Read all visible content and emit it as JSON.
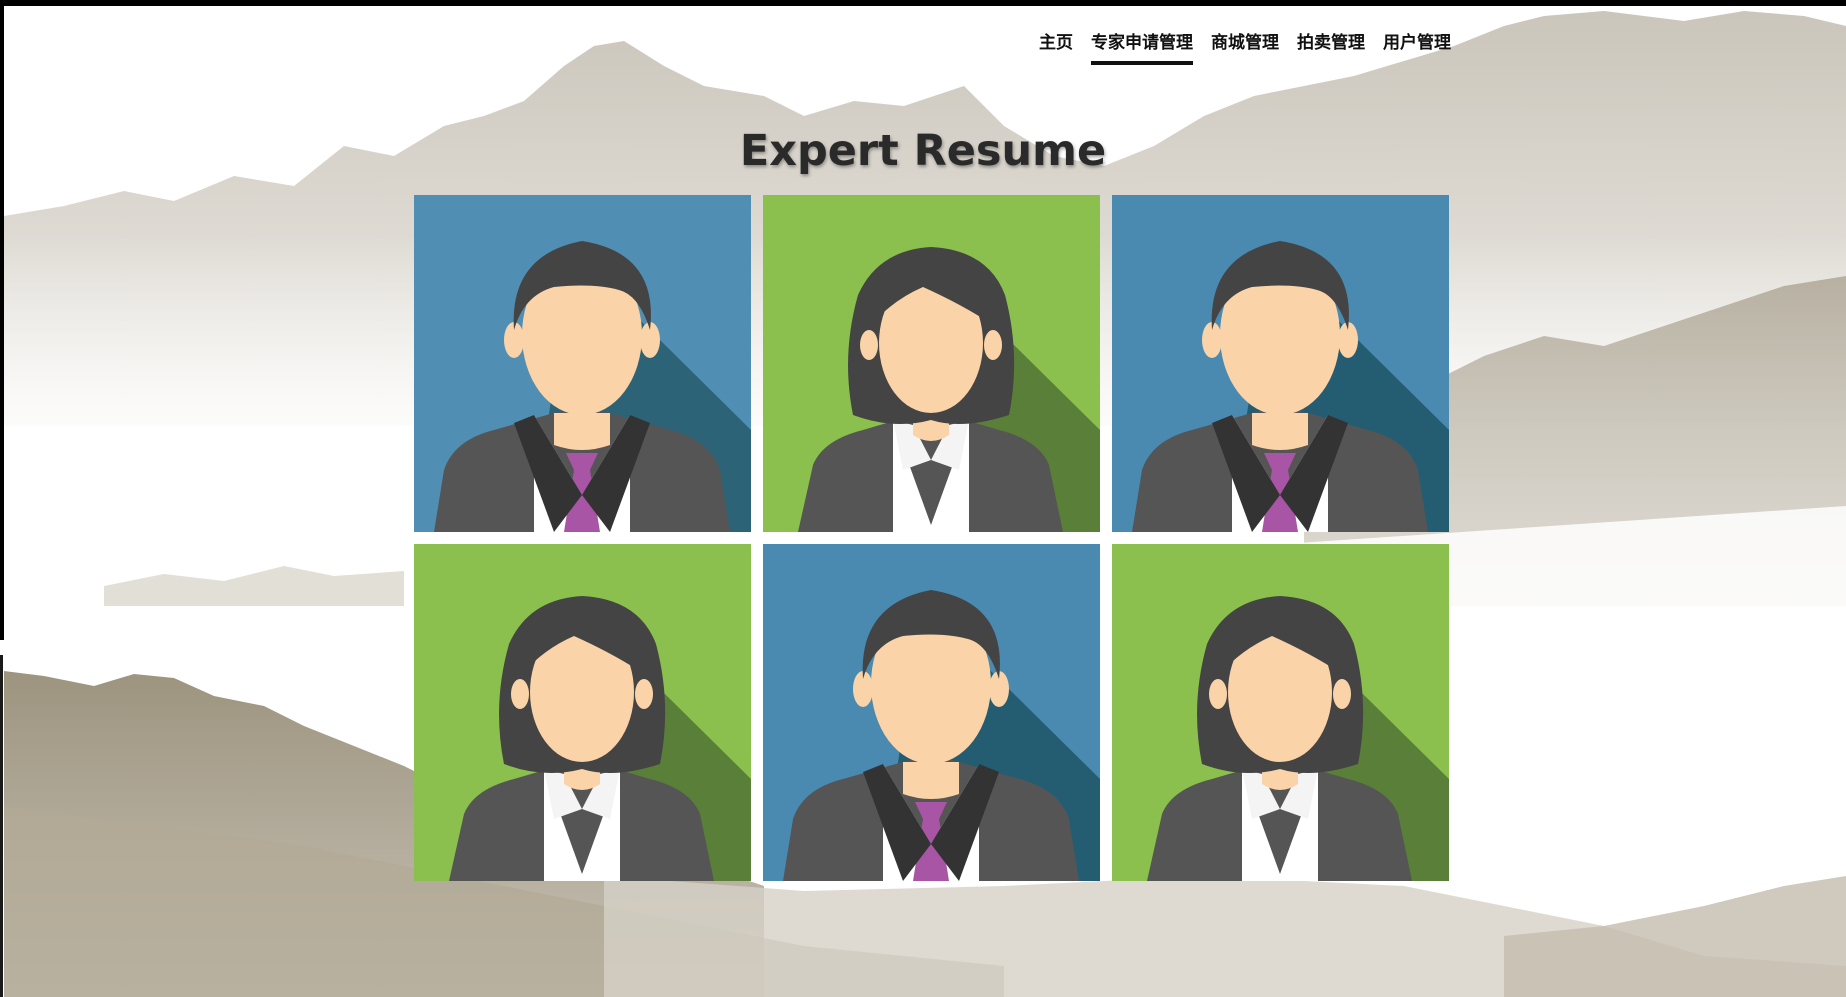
{
  "nav": {
    "items": [
      {
        "label": "主页",
        "active": false
      },
      {
        "label": "专家申请管理",
        "active": true
      },
      {
        "label": "商城管理",
        "active": false
      },
      {
        "label": "拍卖管理",
        "active": false
      },
      {
        "label": "用户管理",
        "active": false
      }
    ]
  },
  "page": {
    "title": "Expert Resume"
  },
  "experts": [
    {
      "avatar": "male-avatar-icon",
      "background": "#4a8ab0"
    },
    {
      "avatar": "female-avatar-icon",
      "background": "#8bc04e"
    },
    {
      "avatar": "male-avatar-icon",
      "background": "#4a8ab0"
    },
    {
      "avatar": "female-avatar-icon",
      "background": "#8bc04e"
    },
    {
      "avatar": "male-avatar-icon",
      "background": "#4a8ab0"
    },
    {
      "avatar": "female-avatar-icon",
      "background": "#8bc04e"
    }
  ],
  "colors": {
    "blue_bg": "#4a8ab0",
    "blue_shadow": "#245d72",
    "green_bg": "#8bc04e",
    "green_shadow": "#5a7f38",
    "hair": "#444444",
    "skin": "#fbd3a8",
    "suit": "#555555",
    "shirt": "#ffffff",
    "tie": "#a855a5"
  }
}
